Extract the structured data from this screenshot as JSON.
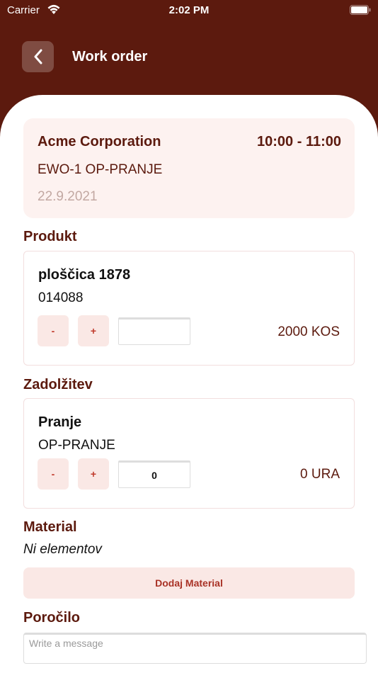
{
  "status_bar": {
    "carrier": "Carrier",
    "time": "2:02 PM"
  },
  "header": {
    "title": "Work order"
  },
  "order": {
    "company": "Acme Corporation",
    "time_range": "10:00 - 11:00",
    "code": "EWO-1 OP-PRANJE",
    "date": "22.9.2021"
  },
  "sections": {
    "product": "Produkt",
    "duty": "Zadolžitev",
    "material": "Material",
    "report": "Poročilo"
  },
  "product": {
    "name": "ploščica 1878",
    "code": "014088",
    "minus_label": "-",
    "plus_label": "+",
    "input_value": "",
    "quantity": "2000 KOS"
  },
  "duty": {
    "name": "Pranje",
    "code": "OP-PRANJE",
    "minus_label": "-",
    "plus_label": "+",
    "input_value": "0",
    "quantity": "0 URA"
  },
  "material": {
    "empty_text": "Ni elementov",
    "add_button_label": "Dodaj Material"
  },
  "report": {
    "placeholder": "Write a message"
  },
  "colors": {
    "brand": "#5c1a0e",
    "card_bg": "#fdf2f0",
    "button_bg": "#fae8e5",
    "button_text": "#c0392b"
  }
}
